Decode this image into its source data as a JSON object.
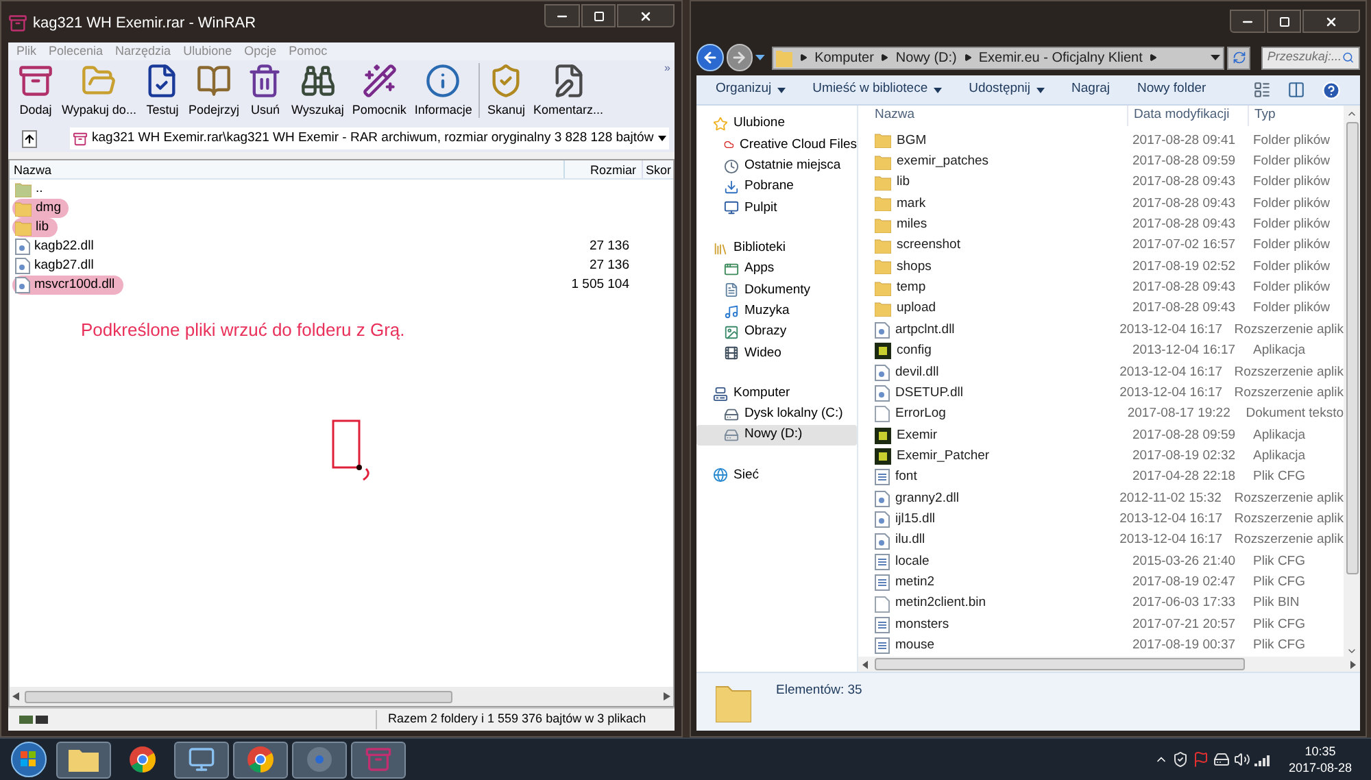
{
  "winrar": {
    "title": "kag321 WH Exemir.rar - WinRAR",
    "menu": [
      "Plik",
      "Polecenia",
      "Narzędzia",
      "Ulubione",
      "Opcje",
      "Pomoc"
    ],
    "toolbar": [
      "Dodaj",
      "Wypakuj do...",
      "Testuj",
      "Podejrzyj",
      "Usuń",
      "Wyszukaj",
      "Pomocnik",
      "Informacje",
      "Skanuj",
      "Komentarz..."
    ],
    "toolbar_more": "»",
    "path": "kag321 WH Exemir.rar\\kag321 WH Exemir - RAR archiwum, rozmiar oryginalny 3 828 128 bajtów",
    "columns": [
      "Nazwa",
      "Rozmiar",
      "Skor"
    ],
    "rows": [
      {
        "kind": "up",
        "name": "..",
        "size": "",
        "highlighted": false
      },
      {
        "kind": "folder",
        "name": "dmg",
        "size": "",
        "highlighted": true
      },
      {
        "kind": "folder",
        "name": "lib",
        "size": "",
        "highlighted": true
      },
      {
        "kind": "dll",
        "name": "kagb22.dll",
        "size": "27 136",
        "highlighted": false
      },
      {
        "kind": "dll",
        "name": "kagb27.dll",
        "size": "27 136",
        "highlighted": false
      },
      {
        "kind": "dll",
        "name": "msvcr100d.dll",
        "size": "1 505 104",
        "highlighted": true
      }
    ],
    "annotation": "Podkreślone pliki wrzuć do folderu z Grą.",
    "status": "Razem 2 foldery i 1 559 376 bajtów w 3 plikach"
  },
  "explorer": {
    "breadcrumb": [
      "Komputer",
      "Nowy (D:)",
      "Exemir.eu - Oficjalny Klient"
    ],
    "search": {
      "placeholder": "Przeszukaj:..."
    },
    "commands": [
      {
        "label": "Organizuj",
        "has_menu": true
      },
      {
        "label": "Umieść w bibliotece",
        "has_menu": true
      },
      {
        "label": "Udostępnij",
        "has_menu": true
      },
      {
        "label": "Nagraj",
        "has_menu": false
      },
      {
        "label": "Nowy folder",
        "has_menu": false
      }
    ],
    "sidebar": [
      {
        "label": "Ulubione",
        "selected": false,
        "children": [
          {
            "label": "Creative Cloud Files",
            "selected": false
          },
          {
            "label": "Ostatnie miejsca",
            "selected": false
          },
          {
            "label": "Pobrane",
            "selected": false
          },
          {
            "label": "Pulpit",
            "selected": false
          }
        ]
      },
      {
        "label": "Biblioteki",
        "selected": false,
        "children": [
          {
            "label": "Apps",
            "selected": false
          },
          {
            "label": "Dokumenty",
            "selected": false
          },
          {
            "label": "Muzyka",
            "selected": false
          },
          {
            "label": "Obrazy",
            "selected": false
          },
          {
            "label": "Wideo",
            "selected": false
          }
        ]
      },
      {
        "label": "Komputer",
        "selected": false,
        "children": [
          {
            "label": "Dysk lokalny (C:)",
            "selected": false
          },
          {
            "label": "Nowy (D:)",
            "selected": true
          }
        ]
      },
      {
        "label": "Sieć",
        "selected": false
      }
    ],
    "columns": [
      "Nazwa",
      "Data modyfikacji",
      "Typ"
    ],
    "rows": [
      {
        "kind": "folder",
        "name": "BGM",
        "date": "2017-08-28 09:41",
        "type": "Folder plików"
      },
      {
        "kind": "folder",
        "name": "exemir_patches",
        "date": "2017-08-28 09:59",
        "type": "Folder plików"
      },
      {
        "kind": "folder",
        "name": "lib",
        "date": "2017-08-28 09:43",
        "type": "Folder plików"
      },
      {
        "kind": "folder",
        "name": "mark",
        "date": "2017-08-28 09:43",
        "type": "Folder plików"
      },
      {
        "kind": "folder",
        "name": "miles",
        "date": "2017-08-28 09:43",
        "type": "Folder plików"
      },
      {
        "kind": "folder",
        "name": "screenshot",
        "date": "2017-07-02 16:57",
        "type": "Folder plików"
      },
      {
        "kind": "folder",
        "name": "shops",
        "date": "2017-08-19 02:52",
        "type": "Folder plików"
      },
      {
        "kind": "folder",
        "name": "temp",
        "date": "2017-08-28 09:43",
        "type": "Folder plików"
      },
      {
        "kind": "folder",
        "name": "upload",
        "date": "2017-08-28 09:43",
        "type": "Folder plików"
      },
      {
        "kind": "dll",
        "name": "artpclnt.dll",
        "date": "2013-12-04 16:17",
        "type": "Rozszerzenie aplik"
      },
      {
        "kind": "app",
        "name": "config",
        "date": "2013-12-04 16:17",
        "type": "Aplikacja"
      },
      {
        "kind": "dll",
        "name": "devil.dll",
        "date": "2013-12-04 16:17",
        "type": "Rozszerzenie aplik"
      },
      {
        "kind": "dll",
        "name": "DSETUP.dll",
        "date": "2013-12-04 16:17",
        "type": "Rozszerzenie aplik"
      },
      {
        "kind": "text",
        "name": "ErrorLog",
        "date": "2017-08-17 19:22",
        "type": "Dokument teksto"
      },
      {
        "kind": "app",
        "name": "Exemir",
        "date": "2017-08-28 09:59",
        "type": "Aplikacja"
      },
      {
        "kind": "app",
        "name": "Exemir_Patcher",
        "date": "2017-08-19 02:32",
        "type": "Aplikacja"
      },
      {
        "kind": "cfg",
        "name": "font",
        "date": "2017-04-28 22:18",
        "type": "Plik CFG"
      },
      {
        "kind": "dll",
        "name": "granny2.dll",
        "date": "2012-11-02 15:32",
        "type": "Rozszerzenie aplik"
      },
      {
        "kind": "dll",
        "name": "ijl15.dll",
        "date": "2013-12-04 16:17",
        "type": "Rozszerzenie aplik"
      },
      {
        "kind": "dll",
        "name": "ilu.dll",
        "date": "2013-12-04 16:17",
        "type": "Rozszerzenie aplik"
      },
      {
        "kind": "cfg",
        "name": "locale",
        "date": "2015-03-26 21:40",
        "type": "Plik CFG"
      },
      {
        "kind": "cfg",
        "name": "metin2",
        "date": "2017-08-19 02:47",
        "type": "Plik CFG"
      },
      {
        "kind": "file",
        "name": "metin2client.bin",
        "date": "2017-06-03 17:33",
        "type": "Plik BIN"
      },
      {
        "kind": "cfg",
        "name": "monsters",
        "date": "2017-07-21 20:57",
        "type": "Plik CFG"
      },
      {
        "kind": "cfg",
        "name": "mouse",
        "date": "2017-08-19 00:37",
        "type": "Plik CFG"
      }
    ],
    "details": "Elementów: 35"
  },
  "taskbar": {
    "time": "10:35",
    "date": "2017-08-28"
  }
}
